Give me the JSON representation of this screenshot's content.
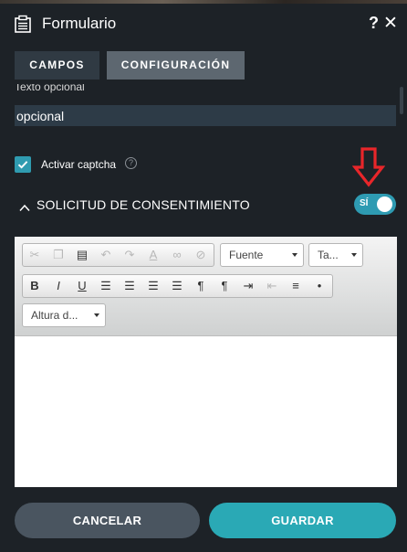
{
  "header": {
    "title": "Formulario",
    "help": "?",
    "close": "✕"
  },
  "tabs": [
    {
      "label": "CAMPOS"
    },
    {
      "label": "CONFIGURACIÓN"
    }
  ],
  "optional_text": {
    "label": "Texto opcional",
    "value": "opcional"
  },
  "captcha": {
    "label": "Activar captcha",
    "checked": true,
    "info": "?"
  },
  "consent": {
    "title": "SOLICITUD DE CONSENTIMIENTO",
    "toggle_label": "SÍ",
    "toggle_on": true
  },
  "editor": {
    "font_combo": "Fuente",
    "size_combo": "Ta...",
    "line_height_combo": "Altura d..."
  },
  "footer": {
    "cancel": "CANCELAR",
    "save": "GUARDAR"
  },
  "colors": {
    "accent": "#2aa9b5",
    "background": "#1d2227",
    "arrow": "#e8262a"
  }
}
